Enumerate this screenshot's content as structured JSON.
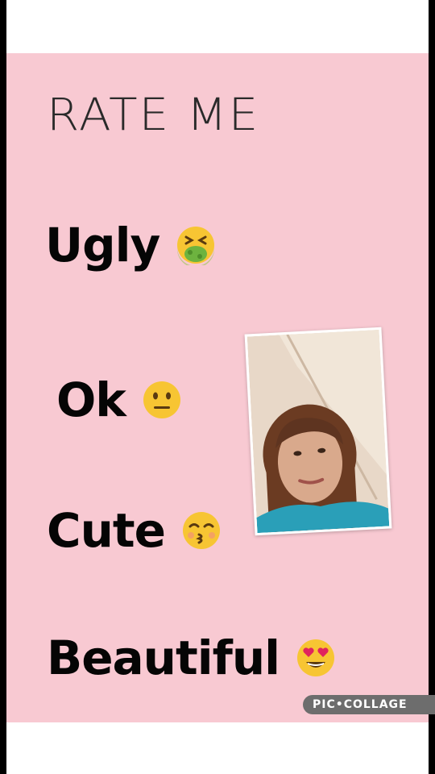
{
  "title": "RATE ME",
  "ratings": [
    {
      "label": "Ugly",
      "emoji": "nauseated-face"
    },
    {
      "label": "Ok",
      "emoji": "neutral-face"
    },
    {
      "label": "Cute",
      "emoji": "kissing-face"
    },
    {
      "label": "Beautiful",
      "emoji": "heart-eyes-face"
    }
  ],
  "watermark": "PIC•COLLAGE",
  "colors": {
    "background": "#f8c9d2",
    "text": "#050505",
    "emoji_yellow": "#f7c533",
    "nausea_green": "#6db33f",
    "heart_red": "#e0245e"
  }
}
